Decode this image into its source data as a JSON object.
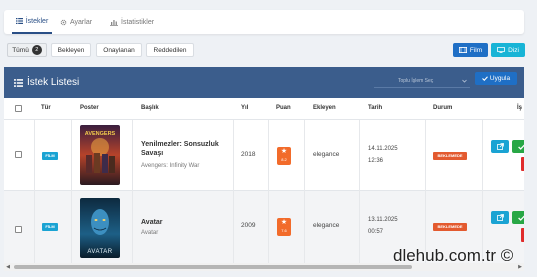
{
  "tabs": [
    {
      "label": "İstekler",
      "icon": "list-icon",
      "active": true
    },
    {
      "label": "Ayarlar",
      "icon": "gear-icon",
      "active": false
    },
    {
      "label": "İstatistikler",
      "icon": "bar-chart-icon",
      "active": false
    }
  ],
  "filters": {
    "all_label": "Tümü",
    "all_count": "2",
    "pending_label": "Bekleyen",
    "approved_label": "Onaylanan",
    "rejected_label": "Reddedilen"
  },
  "actions": {
    "film_label": "Film",
    "dizi_label": "Dizi"
  },
  "list": {
    "title": "İstek Listesi",
    "bulk_placeholder": "Toplu İşlem Seç",
    "apply_label": "Uygula"
  },
  "columns": {
    "type": "Tür",
    "poster": "Poster",
    "title": "Başlık",
    "year": "Yıl",
    "score": "Puan",
    "added_by": "Ekleyen",
    "date": "Tarih",
    "status": "Durum",
    "actions": "İş"
  },
  "rows": [
    {
      "type": "FİLM",
      "title": "Yenilmezler: Sonsuzluk Savaşı",
      "subtitle": "Avengers: Infinity War",
      "year": "2018",
      "score": "8.2",
      "added_by": "elegance",
      "date": "14.11.2025",
      "time": "12:36",
      "status": "BEKLEMEDE",
      "poster_text": "AVENGERS"
    },
    {
      "type": "FİLM",
      "title": "Avatar",
      "subtitle": "Avatar",
      "year": "2009",
      "score": "7.6",
      "added_by": "elegance",
      "date": "13.11.2025",
      "time": "00:57",
      "status": "BEKLEMEDE",
      "poster_text": "AVATAR"
    }
  ],
  "watermark": "dlehub.com.tr ©",
  "colors": {
    "header_blue": "#3b5d8c",
    "primary": "#1f6fc5",
    "info": "#1aa3d3",
    "score": "#f26b2a",
    "status": "#e35a2f",
    "success": "#28a745"
  }
}
